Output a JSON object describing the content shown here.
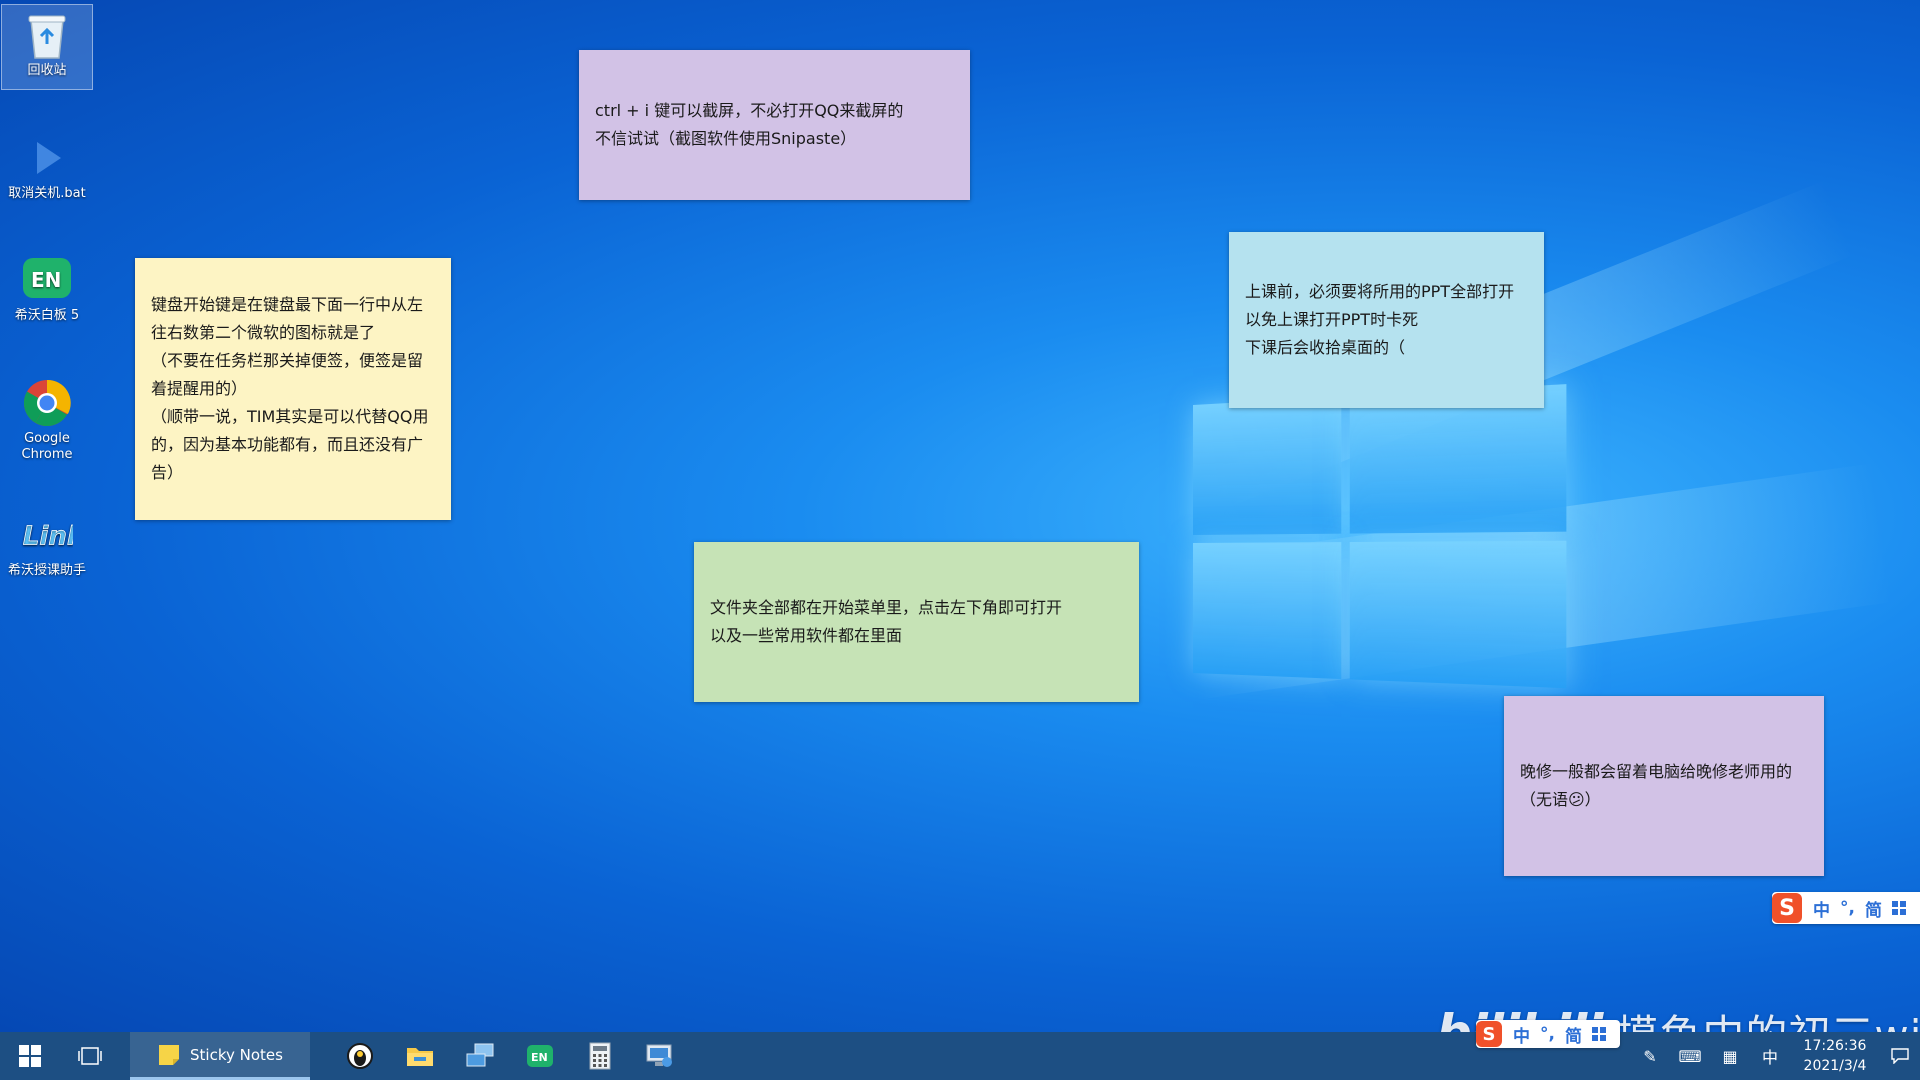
{
  "desktop_icons": [
    {
      "label": "回收站"
    },
    {
      "label": "取消关机.bat"
    },
    {
      "label": "希沃白板 5"
    },
    {
      "label": "Google Chrome"
    },
    {
      "label": "希沃授课助手"
    }
  ],
  "notes": {
    "note1": {
      "text": "ctrl + i 键可以截屏，不必打开QQ来截屏的\n不信试试（截图软件使用Snipaste）"
    },
    "note2": {
      "text": "键盘开始键是在键盘最下面一行中从左往右数第二个微软的图标就是了\n（不要在任务栏那关掉便签，便签是留着提醒用的）\n（顺带一说，TIM其实是可以代替QQ用的，因为基本功能都有，而且还没有广告）"
    },
    "note3": {
      "text": "上课前，必须要将所用的PPT全部打开\n以免上课打开PPT时卡死\n下课后会收拾桌面的（"
    },
    "note4": {
      "text": "文件夹全部都在开始菜单里，点击左下角即可打开\n以及一些常用软件都在里面"
    },
    "note5": {
      "text": "晚修一般都会留着电脑给晚修老师用的\n（无语😕）"
    }
  },
  "ime": {
    "logo": "S",
    "mode": "中",
    "punct": "°,",
    "script": "简"
  },
  "taskbar": {
    "sticky_label": "Sticky Notes",
    "tray_ime": "中",
    "time": "17:26:36",
    "date": "2021/3/4"
  },
  "watermark": {
    "logo": "bilibili",
    "text": "摸鱼中的初三win"
  },
  "colors": {
    "note_purple": "#d2c2e6",
    "note_yellow": "#fdf4c4",
    "note_blue": "#b5e2ef",
    "note_green": "#c6e3b6",
    "taskbar": "#1d4f83"
  }
}
